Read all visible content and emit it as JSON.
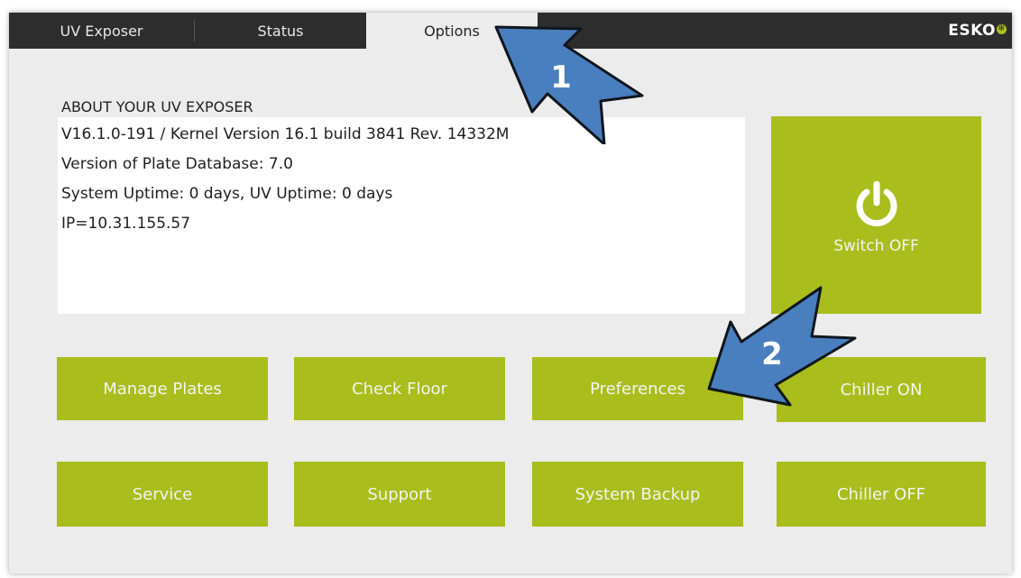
{
  "tabs": [
    {
      "label": "UV Exposer",
      "active": false
    },
    {
      "label": "Status",
      "active": false
    },
    {
      "label": "Options",
      "active": true
    }
  ],
  "brand": {
    "logo_text": "ESKO",
    "accent_color": "#a9bd1c",
    "topbar_color": "#2d2d2d"
  },
  "about": {
    "title": "ABOUT YOUR UV EXPOSER",
    "lines": [
      "V16.1.0-191 / Kernel Version 16.1 build 3841 Rev. 14332M",
      "Version of Plate Database: 7.0",
      "System Uptime: 0 days, UV Uptime: 0 days",
      "IP=10.31.155.57"
    ]
  },
  "power": {
    "label": "Switch OFF",
    "icon": "power-icon"
  },
  "buttons": {
    "manage_plates": "Manage Plates",
    "check_floor": "Check Floor",
    "preferences": "Preferences",
    "chiller_on": "Chiller ON",
    "service": "Service",
    "support": "Support",
    "system_backup": "System Backup",
    "chiller_off": "Chiller OFF"
  },
  "annotations": {
    "arrow_1": "1",
    "arrow_2": "2",
    "arrow_color": "#4a7fbf"
  }
}
